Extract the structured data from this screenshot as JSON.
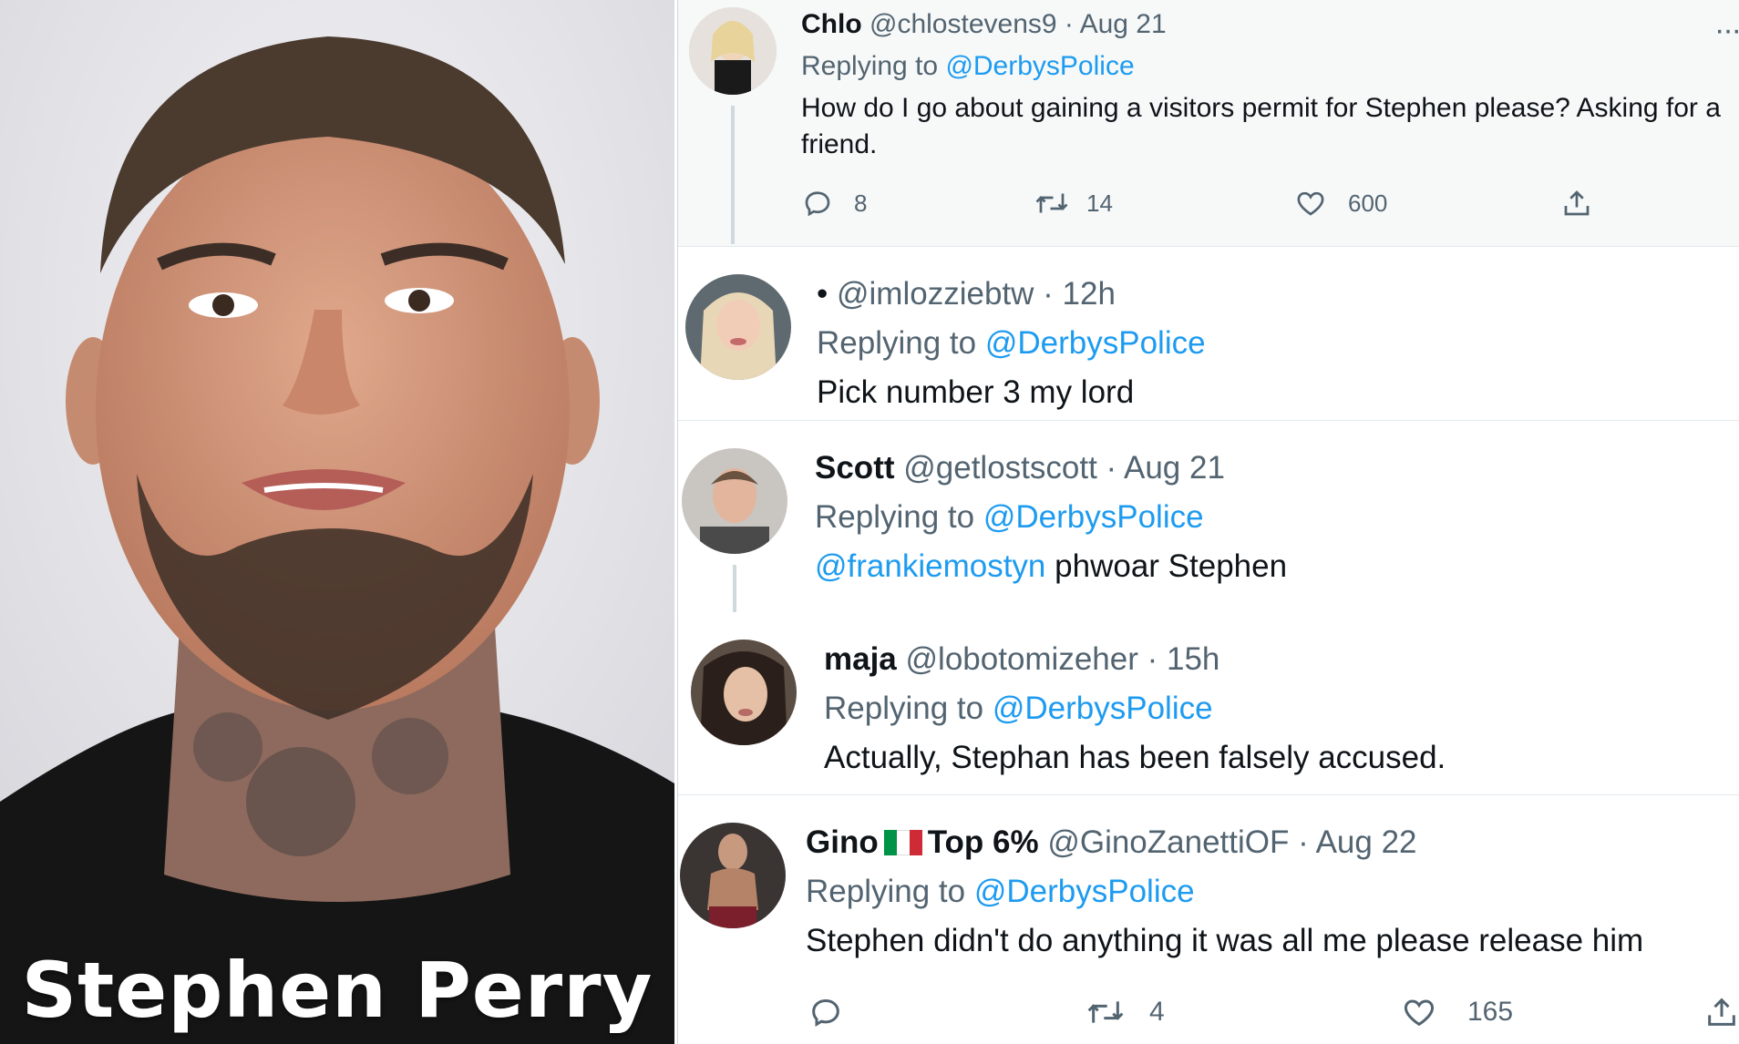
{
  "caption": "Stephen Perry",
  "tweets": [
    {
      "name": "Chlo",
      "handle": "@chlostevens9",
      "time": "· Aug 21",
      "replying_label": "Replying to",
      "replying_to": "@DerbysPolice",
      "text_line1": "How do I go about gaining a visitors permit for Stephen please? Asking for a",
      "text_line2": "friend.",
      "replies": "8",
      "retweets": "14",
      "likes": "600",
      "more": "···"
    },
    {
      "bullet": "•",
      "handle": "@imlozziebtw",
      "time": "· 12h",
      "replying_label": "Replying to",
      "replying_to": "@DerbysPolice",
      "text": "Pick number 3 my lord"
    },
    {
      "name": "Scott",
      "handle": "@getlostscott",
      "time": "· Aug 21",
      "replying_label": "Replying to",
      "replying_to": "@DerbysPolice",
      "mention": "@frankiemostyn",
      "text": "phwoar Stephen"
    },
    {
      "name": "maja",
      "handle": "@lobotomizeher",
      "time": "· 15h",
      "replying_label": "Replying to",
      "replying_to": "@DerbysPolice",
      "text": "Actually, Stephan has been falsely accused."
    },
    {
      "name": "Gino",
      "badge": "Top 6%",
      "handle": "@GinoZanettiOF",
      "time": "· Aug 22",
      "replying_label": "Replying to",
      "replying_to": "@DerbysPolice",
      "text": "Stephen didn't do anything it was all me please release him",
      "replies": "",
      "retweets": "4",
      "likes": "165"
    }
  ],
  "icons": {
    "reply": "reply-icon",
    "retweet": "retweet-icon",
    "like": "heart-icon",
    "share": "share-icon",
    "flag": "italy-flag-icon"
  },
  "colors": {
    "link": "#1d9bf0",
    "muted": "#536471",
    "text": "#0f1419",
    "flag_green": "#009246",
    "flag_white": "#ffffff",
    "flag_red": "#ce2b37"
  }
}
